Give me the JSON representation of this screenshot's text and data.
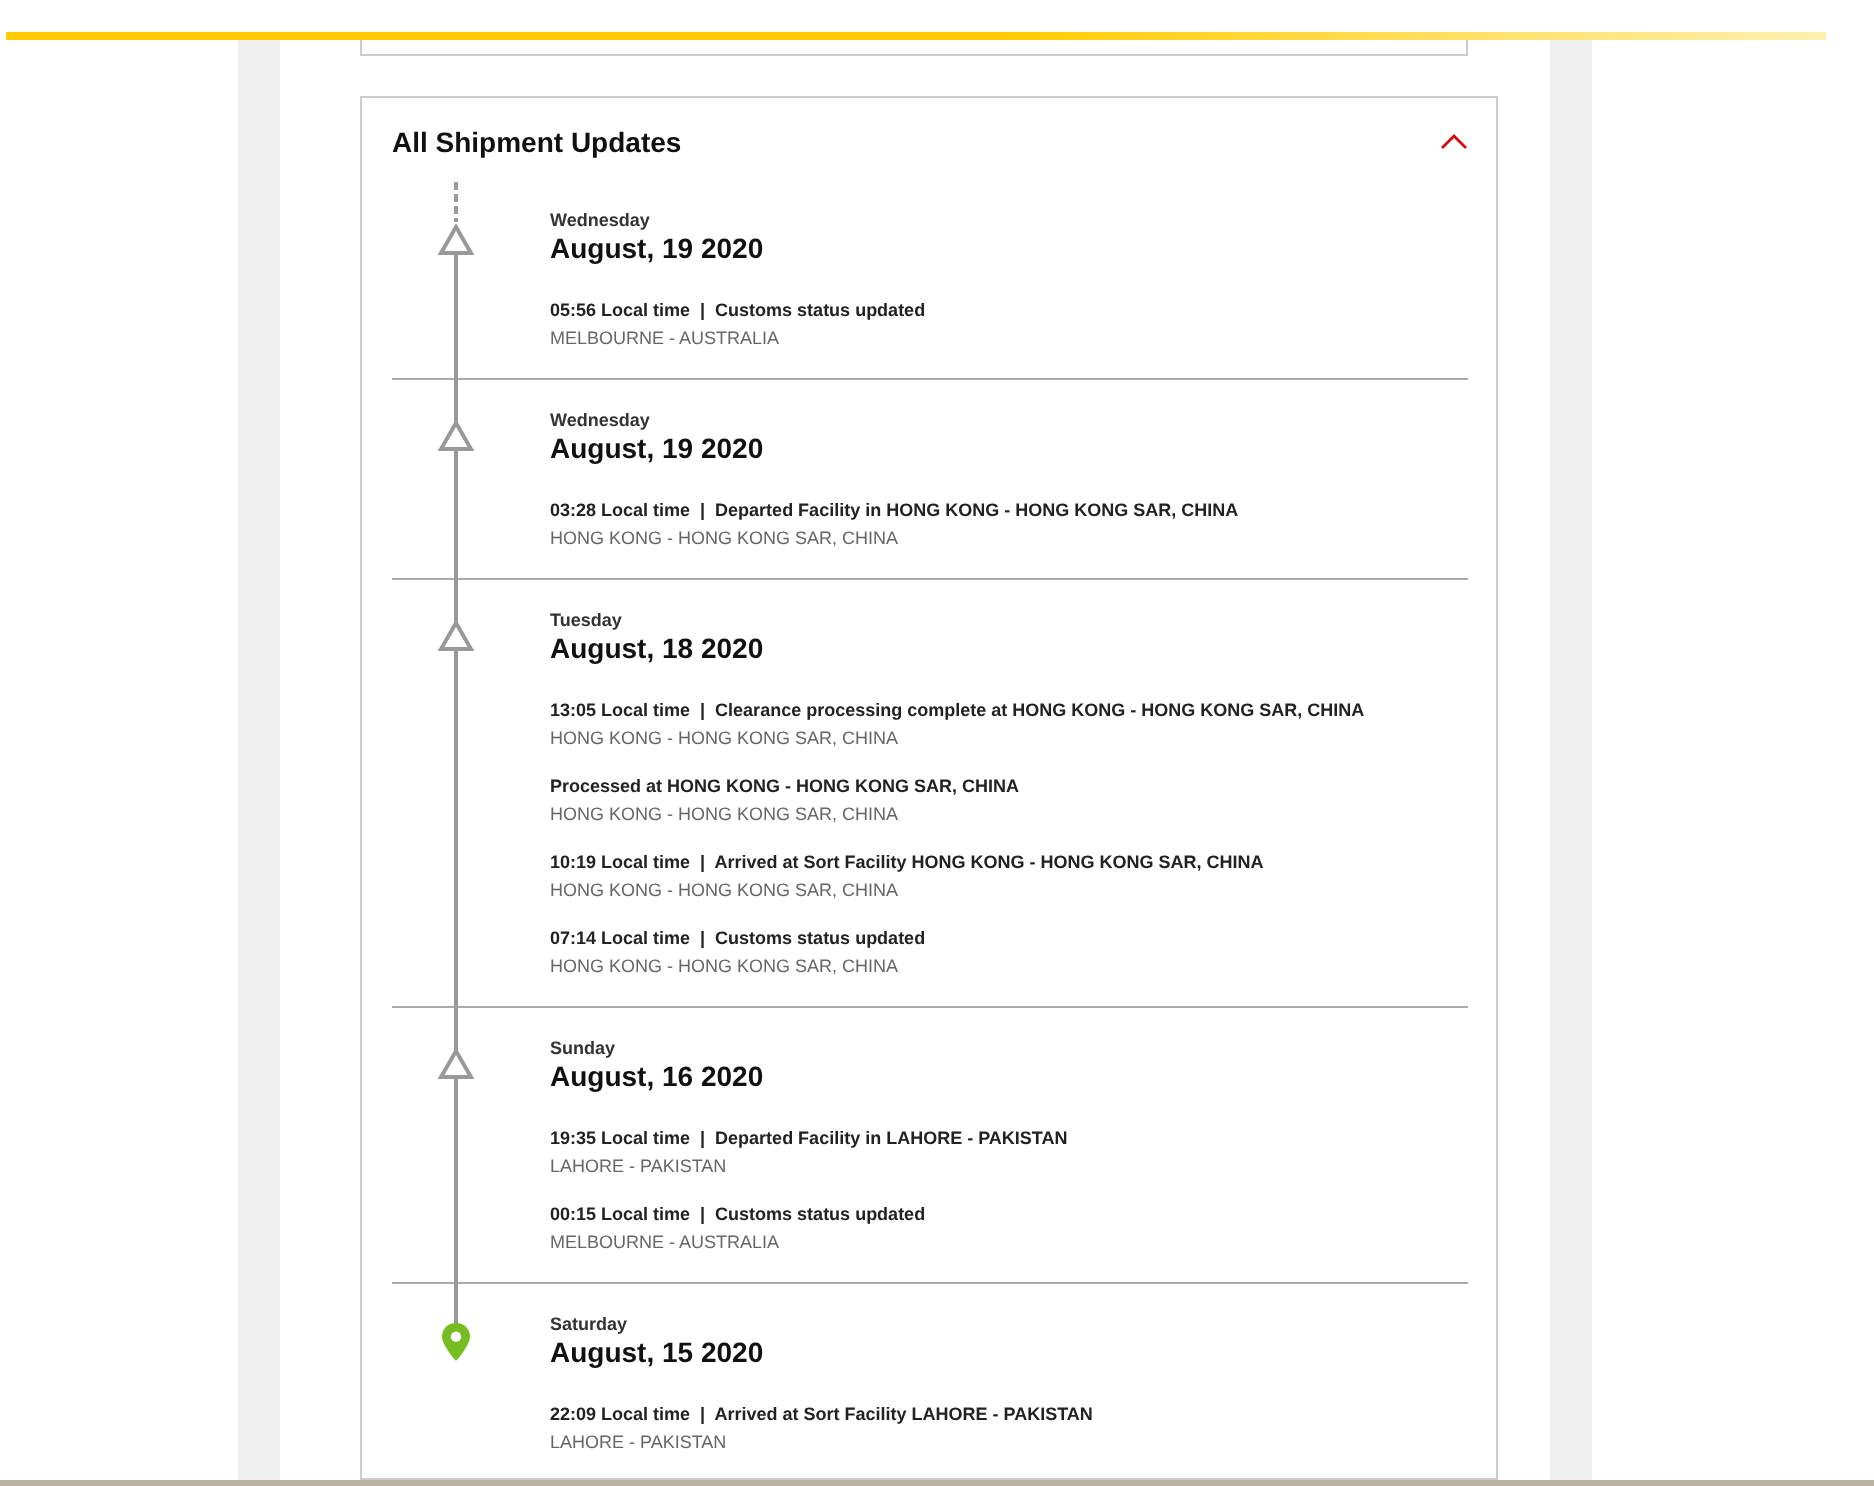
{
  "section": {
    "title": "All Shipment Updates",
    "expanded": true
  },
  "groups": [
    {
      "kind": "triangle",
      "weekday": "Wednesday",
      "date": "August, 19 2020",
      "events": [
        {
          "title": "05:56 Local time  |  Customs status updated",
          "location": "MELBOURNE - AUSTRALIA"
        }
      ]
    },
    {
      "kind": "triangle",
      "weekday": "Wednesday",
      "date": "August, 19 2020",
      "events": [
        {
          "title": "03:28 Local time  |  Departed Facility in HONG KONG - HONG KONG SAR, CHINA",
          "location": "HONG KONG - HONG KONG SAR, CHINA"
        }
      ]
    },
    {
      "kind": "triangle",
      "weekday": "Tuesday",
      "date": "August, 18 2020",
      "events": [
        {
          "title": "13:05 Local time  |  Clearance processing complete at HONG KONG - HONG KONG SAR, CHINA",
          "location": "HONG KONG - HONG KONG SAR, CHINA"
        },
        {
          "title": "Processed at HONG KONG - HONG KONG SAR, CHINA",
          "location": "HONG KONG - HONG KONG SAR, CHINA"
        },
        {
          "title": "10:19 Local time  |  Arrived at Sort Facility HONG KONG - HONG KONG SAR, CHINA",
          "location": "HONG KONG - HONG KONG SAR, CHINA"
        },
        {
          "title": "07:14 Local time  |  Customs status updated",
          "location": "HONG KONG - HONG KONG SAR, CHINA"
        }
      ]
    },
    {
      "kind": "triangle",
      "weekday": "Sunday",
      "date": "August, 16 2020",
      "events": [
        {
          "title": "19:35 Local time  |  Departed Facility in LAHORE - PAKISTAN",
          "location": "LAHORE - PAKISTAN"
        },
        {
          "title": "00:15 Local time  |  Customs status updated",
          "location": "MELBOURNE - AUSTRALIA"
        }
      ]
    },
    {
      "kind": "pin",
      "weekday": "Saturday",
      "date": "August, 15 2020",
      "events": [
        {
          "title": "22:09 Local time  |  Arrived at Sort Facility LAHORE - PAKISTAN",
          "location": "LAHORE - PAKISTAN"
        }
      ]
    }
  ]
}
